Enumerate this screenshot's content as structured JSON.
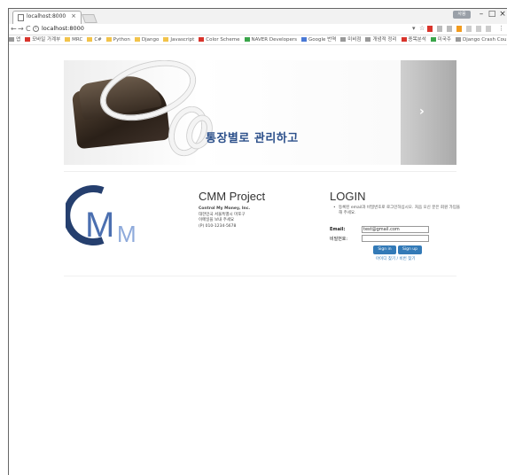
{
  "browser": {
    "tab_title": "localhost:8000",
    "tab_close": "×",
    "user_label": "사용",
    "url": "localhost:8000",
    "nav": {
      "back": "←",
      "forward": "→",
      "reload": "C"
    },
    "window": {
      "minimize": "–",
      "maximize": "□",
      "close": "×"
    }
  },
  "bookmarks": [
    {
      "icon": "gray",
      "label": "앱"
    },
    {
      "icon": "red",
      "label": "모바일 가계부"
    },
    {
      "icon": "folder",
      "label": "MRC"
    },
    {
      "icon": "folder",
      "label": "C#"
    },
    {
      "icon": "folder",
      "label": "Python"
    },
    {
      "icon": "folder",
      "label": "Django"
    },
    {
      "icon": "folder",
      "label": "Javascript"
    },
    {
      "icon": "red",
      "label": "Color Scheme"
    },
    {
      "icon": "green",
      "label": "NAVER Developers"
    },
    {
      "icon": "blue",
      "label": "Google 번역"
    },
    {
      "icon": "gray",
      "label": "미비점"
    },
    {
      "icon": "gray",
      "label": "개념적 정리"
    },
    {
      "icon": "red",
      "label": "종목분석"
    },
    {
      "icon": "green",
      "label": "미국주"
    },
    {
      "icon": "gray",
      "label": "Django Crash Course"
    }
  ],
  "carousel": {
    "caption": "통장별로 관리하고",
    "next_label": "›"
  },
  "project": {
    "title": "CMM Project",
    "lines": [
      "Control My Money, Inc.",
      "대한민국 서울특별시 마포구",
      "이메일을 보내 주세요",
      "(P) 010-1234-5678"
    ]
  },
  "login": {
    "title": "LOGIN",
    "notice": "등록된 email과 비밀번호로 로그인하십시오. 처음 오신 분은 회원 가입을 해 주세요.",
    "email_label": "Email:",
    "email_value": "test@gmail.com",
    "password_label": "비밀번호:",
    "password_value": "",
    "signin_label": "Sign in",
    "signup_label": "Sign up",
    "forgot_label": "아이디 찾기 / 비번 찾기"
  },
  "colors": {
    "primary": "#337ab7",
    "caption": "#2b4f8a",
    "logo_dark": "#253f6e",
    "logo_light": "#8eaadb"
  }
}
